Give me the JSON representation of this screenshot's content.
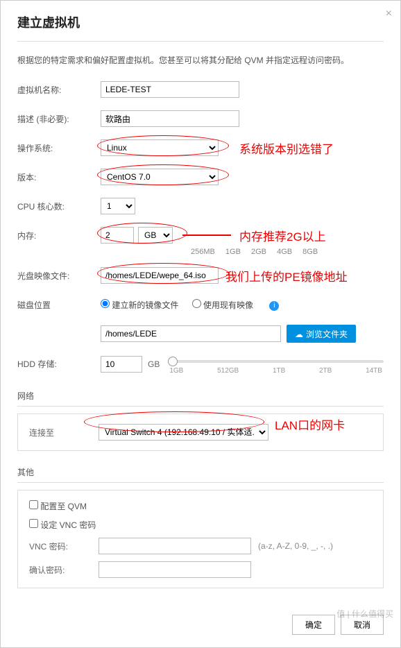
{
  "dialog": {
    "title": "建立虚拟机",
    "intro": "根据您的特定需求和偏好配置虚拟机。您甚至可以将其分配给 QVM 并指定远程访问密码。"
  },
  "labels": {
    "vm_name": "虚拟机名称:",
    "description": "描述 (非必要):",
    "os": "操作系统:",
    "version": "版本:",
    "cpu_cores": "CPU 核心数:",
    "memory": "内存:",
    "iso": "光盘映像文件:",
    "disk_location": "磁盘位置",
    "hdd_storage": "HDD 存储:",
    "network": "网络",
    "connect_to": "连接至",
    "other": "其他",
    "assign_qvm": "配置至 QVM",
    "set_vnc": "设定 VNC 密码",
    "vnc_pwd": "VNC 密码:",
    "confirm_pwd": "确认密码:"
  },
  "values": {
    "vm_name": "LEDE-TEST",
    "description": "软路由",
    "os": "Linux",
    "version": "CentOS 7.0",
    "cpu_cores": "1",
    "memory_amount": "2",
    "memory_unit": "GB",
    "iso_path": "/homes/LEDE/wepe_64.iso",
    "disk_path": "/homes/LEDE",
    "hdd_amount": "10",
    "hdd_unit": "GB",
    "network_switch": "Virtual Switch 4 (192.168.49.10 / 实体适...",
    "vnc_pwd": "",
    "confirm_pwd": ""
  },
  "radio": {
    "new_image": "建立新的镜像文件",
    "existing_image": "使用现有映像"
  },
  "memory_presets": [
    "256MB",
    "1GB",
    "2GB",
    "4GB",
    "8GB"
  ],
  "hdd_ticks": [
    "1GB",
    "512GB",
    "1TB",
    "2TB",
    "14TB"
  ],
  "buttons": {
    "browse": "浏览文件夹",
    "ok": "确定",
    "cancel": "取消"
  },
  "hints": {
    "password_rule": "(a-z, A-Z, 0-9, _, -, .)"
  },
  "annotations": {
    "os_note": "系统版本别选错了",
    "memory_note": "内存推荐2G以上",
    "iso_note": "我们上传的PE镜像地址",
    "network_note": "LAN口的网卡"
  },
  "watermark": "值 | 什么值得买"
}
